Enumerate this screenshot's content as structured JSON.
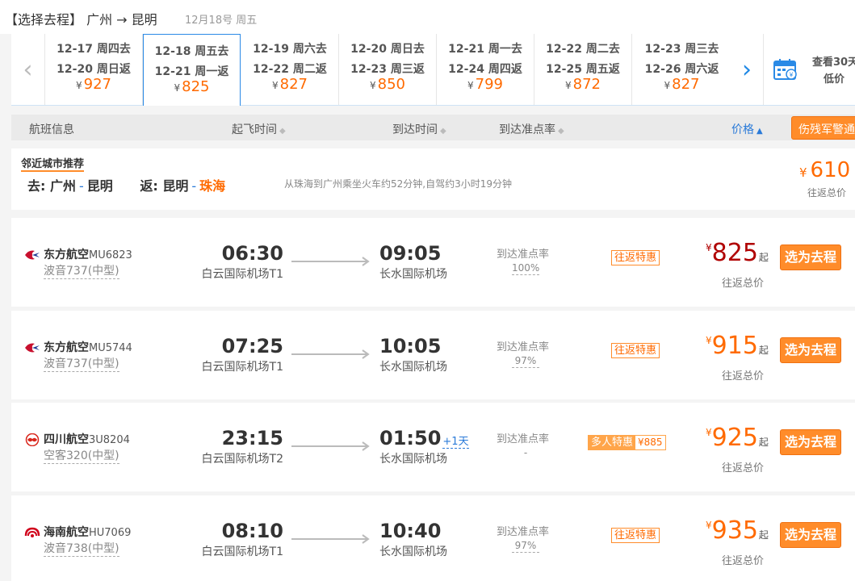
{
  "header": {
    "title": "【选择去程】 广州 → 昆明",
    "date": "12月18号 周五"
  },
  "date_strip": {
    "cells": [
      {
        "go": "12-17 周四去",
        "back": "12-20 周日返",
        "yen": "¥",
        "price": "927",
        "selected": false
      },
      {
        "go": "12-18 周五去",
        "back": "12-21 周一返",
        "yen": "¥",
        "price": "825",
        "selected": true
      },
      {
        "go": "12-19 周六去",
        "back": "12-22 周二返",
        "yen": "¥",
        "price": "827",
        "selected": false
      },
      {
        "go": "12-20 周日去",
        "back": "12-23 周三返",
        "yen": "¥",
        "price": "850",
        "selected": false
      },
      {
        "go": "12-21 周一去",
        "back": "12-24 周四返",
        "yen": "¥",
        "price": "799",
        "selected": false
      },
      {
        "go": "12-22 周二去",
        "back": "12-25 周五返",
        "yen": "¥",
        "price": "872",
        "selected": false
      },
      {
        "go": "12-23 周三去",
        "back": "12-26 周六返",
        "yen": "¥",
        "price": "827",
        "selected": false
      }
    ],
    "calendar_line1": "查看30天",
    "calendar_line2": "低价"
  },
  "sort_bar": {
    "flight_info": "航班信息",
    "depart_time": "起飞时间",
    "arrive_time": "到达时间",
    "on_time_rate": "到达准点率",
    "price": "价格",
    "sort_arrow": "◆",
    "price_arrow": "▲",
    "promo": "伤残军警通道"
  },
  "nearby": {
    "title": "邻近城市推荐",
    "go_label": "去:",
    "go_from": "广州",
    "go_to": "昆明",
    "ret_label": "返:",
    "ret_from": "昆明",
    "ret_to": "珠海",
    "dash": "-",
    "note": "从珠海到广州乘坐火车约52分钟,自驾约3小时19分钟",
    "yen": "¥",
    "price": "610",
    "price_label": "往返总价"
  },
  "flights": [
    {
      "airline": "东方航空",
      "flight_no": "MU6823",
      "plane": "波音737(中型)",
      "dep_time": "06:30",
      "dep_airport": "白云国际机场T1",
      "arr_time": "09:05",
      "arr_plus": "",
      "arr_airport": "长水国际机场",
      "ontime_label": "到达准点率",
      "ontime": "100%",
      "tag": "往返特惠",
      "tag_b": "",
      "yen": "¥",
      "price": "825",
      "qi": "起",
      "price_label": "往返总价",
      "button": "选为去程"
    },
    {
      "airline": "东方航空",
      "flight_no": "MU5744",
      "plane": "波音737(中型)",
      "dep_time": "07:25",
      "dep_airport": "白云国际机场T1",
      "arr_time": "10:05",
      "arr_plus": "",
      "arr_airport": "长水国际机场",
      "ontime_label": "到达准点率",
      "ontime": "97%",
      "tag": "往返特惠",
      "tag_b": "",
      "yen": "¥",
      "price": "915",
      "qi": "起",
      "price_label": "往返总价",
      "button": "选为去程"
    },
    {
      "airline": "四川航空",
      "flight_no": "3U8204",
      "plane": "空客320(中型)",
      "dep_time": "23:15",
      "dep_airport": "白云国际机场T2",
      "arr_time": "01:50",
      "arr_plus": "+1天",
      "arr_airport": "长水国际机场",
      "ontime_label": "到达准点率",
      "ontime": "-",
      "tag": "多人特惠",
      "tag_b": "¥885",
      "yen": "¥",
      "price": "925",
      "qi": "起",
      "price_label": "往返总价",
      "button": "选为去程"
    },
    {
      "airline": "海南航空",
      "flight_no": "HU7069",
      "plane": "波音738(中型)",
      "dep_time": "08:10",
      "dep_airport": "白云国际机场T1",
      "arr_time": "10:40",
      "arr_plus": "",
      "arr_airport": "长水国际机场",
      "ontime_label": "到达准点率",
      "ontime": "97%",
      "tag": "往返特惠",
      "tag_b": "",
      "yen": "¥",
      "price": "935",
      "qi": "起",
      "price_label": "往返总价",
      "button": "选为去程"
    }
  ],
  "colors": {
    "accent_orange": "#ff8c2a",
    "price_orange": "#ff6a00",
    "price_dark_red": "#b00000",
    "selected_blue": "#2a8ae6",
    "eastern_red": "#c8102e",
    "sichuan_red": "#d9261c",
    "hainan_red": "#d0021b"
  }
}
